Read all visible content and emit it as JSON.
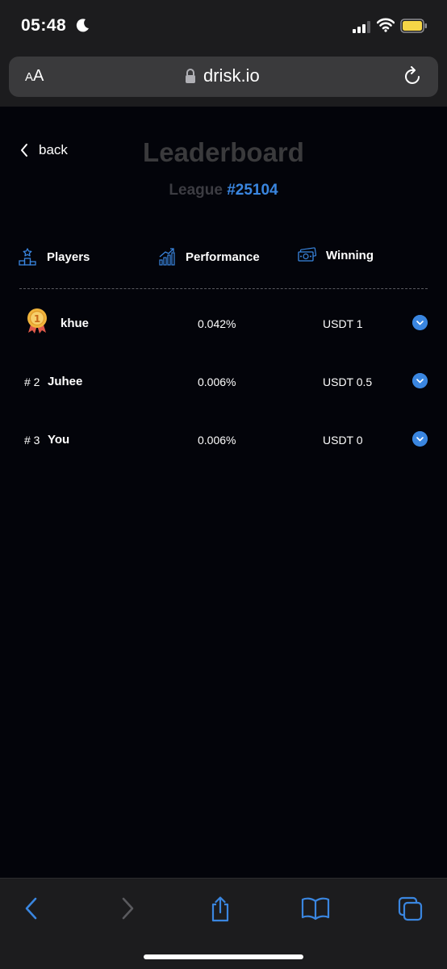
{
  "status_bar": {
    "time": "05:48"
  },
  "browser": {
    "aa_small": "A",
    "aa_large": "A",
    "url": "drisk.io"
  },
  "page": {
    "back_label": "back",
    "title": "Leaderboard",
    "league_label": "League",
    "league_id": "#25104"
  },
  "columns": {
    "players": "Players",
    "performance": "Performance",
    "winning": "Winning"
  },
  "rows": [
    {
      "rank": "",
      "name": "khue",
      "performance": "0.042%",
      "winning": "USDT 1",
      "medal": "1"
    },
    {
      "rank": "# 2",
      "name": "Juhee",
      "performance": "0.006%",
      "winning": "USDT 0.5"
    },
    {
      "rank": "# 3",
      "name": "You",
      "performance": "0.006%",
      "winning": "USDT 0"
    }
  ],
  "colors": {
    "accent": "#3a86e0",
    "background": "#03040a",
    "title_muted": "#3a3a3c"
  }
}
